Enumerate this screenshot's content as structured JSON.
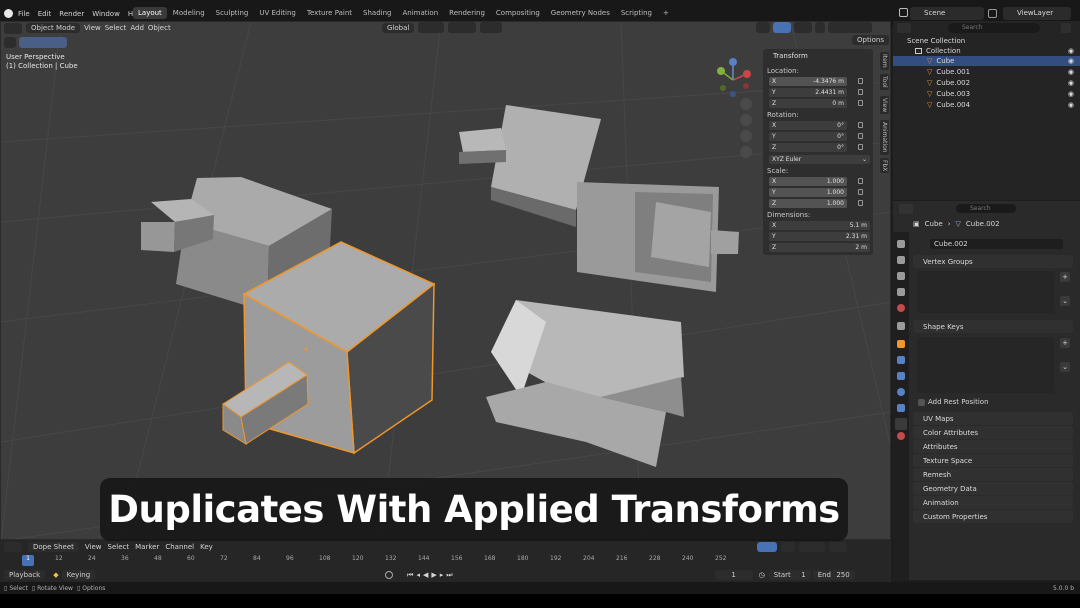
{
  "topbar": {
    "menus": [
      "File",
      "Edit",
      "Render",
      "Window",
      "Help"
    ],
    "workspaces": [
      "Layout",
      "Modeling",
      "Sculpting",
      "UV Editing",
      "Texture Paint",
      "Shading",
      "Animation",
      "Rendering",
      "Compositing",
      "Geometry Nodes",
      "Scripting"
    ],
    "active_workspace": "Layout",
    "scene": "Scene",
    "view_layer": "ViewLayer",
    "plus": "+"
  },
  "viewport": {
    "mode": "Object Mode",
    "menus": [
      "View",
      "Select",
      "Add",
      "Object"
    ],
    "transform_orientation": "Global",
    "options": "Options",
    "perspective": "User Perspective",
    "collection_info": "(1) Collection | Cube"
  },
  "npanel": {
    "title": "Transform",
    "location_label": "Location:",
    "location": [
      {
        "axis": "X",
        "value": "-4.3476 m"
      },
      {
        "axis": "Y",
        "value": "2.4431 m"
      },
      {
        "axis": "Z",
        "value": "0 m"
      }
    ],
    "rotation_label": "Rotation:",
    "rotation": [
      {
        "axis": "X",
        "value": "0°"
      },
      {
        "axis": "Y",
        "value": "0°"
      },
      {
        "axis": "Z",
        "value": "0°"
      }
    ],
    "rotation_mode": "XYZ Euler",
    "scale_label": "Scale:",
    "scale": [
      {
        "axis": "X",
        "value": "1.000"
      },
      {
        "axis": "Y",
        "value": "1.000"
      },
      {
        "axis": "Z",
        "value": "1.000"
      }
    ],
    "dimensions_label": "Dimensions:",
    "dimensions": [
      {
        "axis": "X",
        "value": "5.1 m"
      },
      {
        "axis": "Y",
        "value": "2.31 m"
      },
      {
        "axis": "Z",
        "value": "2 m"
      }
    ],
    "tabs": [
      "Item",
      "Tool",
      "View",
      "Animation",
      "FbX"
    ]
  },
  "outliner": {
    "search_placeholder": "Search",
    "scene_collection": "Scene Collection",
    "collection": "Collection",
    "objects": [
      "Cube",
      "Cube.001",
      "Cube.002",
      "Cube.003",
      "Cube.004"
    ],
    "selected": "Cube"
  },
  "properties": {
    "search_placeholder": "Search",
    "breadcrumb_object": "Cube",
    "breadcrumb_mesh": "Cube.002",
    "mesh_name": "Cube.002",
    "vertex_groups": "Vertex Groups",
    "shape_keys": "Shape Keys",
    "add_rest_position": "Add Rest Position",
    "sections": [
      "UV Maps",
      "Color Attributes",
      "Attributes",
      "Texture Space",
      "Remesh",
      "Geometry Data",
      "Animation",
      "Custom Properties"
    ]
  },
  "timeline": {
    "editor": "Dope Sheet",
    "menus": [
      "View",
      "Select",
      "Marker",
      "Channel",
      "Key"
    ],
    "frames": [
      "1",
      "12",
      "24",
      "36",
      "48",
      "60",
      "72",
      "84",
      "96",
      "108",
      "120",
      "132",
      "144",
      "156",
      "168",
      "180",
      "192",
      "204",
      "216",
      "228",
      "240",
      "252"
    ],
    "playback": "Playback",
    "keying": "Keying",
    "current_frame": "1",
    "start_label": "Start",
    "start": "1",
    "end_label": "End",
    "end": "250"
  },
  "statusbar": {
    "items": [
      "Select",
      "Rotate View",
      "Options"
    ],
    "version": "5.0.0 b"
  },
  "caption": "Duplicates With Applied Transforms",
  "colors": {
    "selection_outline": "#f0962a",
    "accent": "#4772b3",
    "viewport_bg": "#3d3d3d"
  }
}
